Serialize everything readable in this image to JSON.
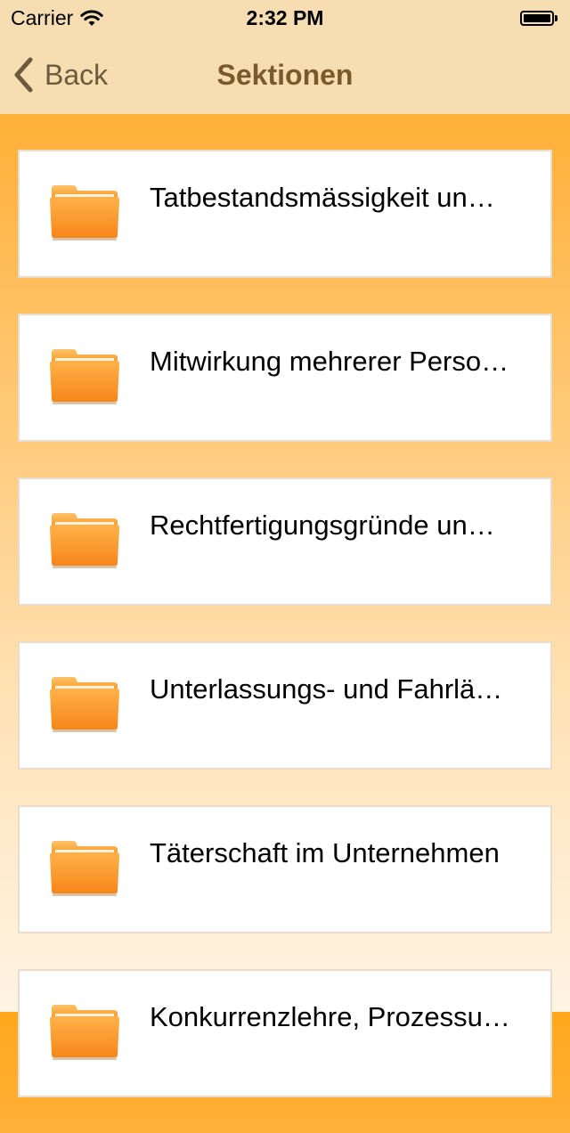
{
  "status_bar": {
    "carrier": "Carrier",
    "time": "2:32 PM"
  },
  "nav": {
    "back_label": "Back",
    "title": "Sektionen"
  },
  "sections": [
    {
      "label": "Tatbestandsmässigkeit un…"
    },
    {
      "label": "Mitwirkung mehrerer Perso…"
    },
    {
      "label": "Rechtfertigungsgründe un…"
    },
    {
      "label": "Unterlassungs- und Fahrlä…"
    },
    {
      "label": "Täterschaft im Unternehmen"
    },
    {
      "label": "Konkurrenzlehre, Prozessu…"
    }
  ],
  "icons": {
    "back": "chevron-left-icon",
    "folder": "folder-icon",
    "wifi": "wifi-icon",
    "battery": "battery-icon"
  },
  "colors": {
    "nav_background": "#f6deb2",
    "title_color": "#7a5a2a",
    "back_color": "#6b5a3b",
    "folder": "#ffa030",
    "background_top": "#ffa81c",
    "background_bottom": "#fff4e4"
  }
}
